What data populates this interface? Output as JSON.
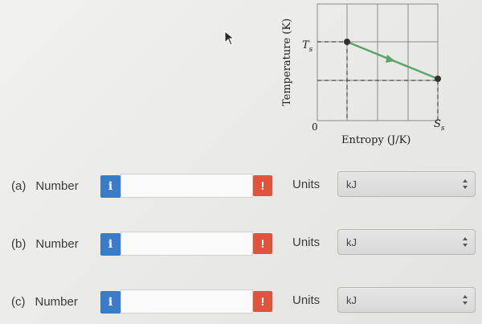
{
  "diagram": {
    "y_axis_label": "Temperature (K)",
    "x_axis_label": "Entropy (J/K)",
    "origin_label": "0",
    "y_marker_label": "T",
    "y_marker_sub": "s",
    "x_marker_label": "S",
    "x_marker_sub": "s"
  },
  "rows": [
    {
      "letter": "(a)",
      "label": "Number",
      "info_icon_text": "i",
      "value": "",
      "warn_icon_text": "!",
      "units_label": "Units",
      "units_value": "kJ"
    },
    {
      "letter": "(b)",
      "label": "Number",
      "info_icon_text": "i",
      "value": "",
      "warn_icon_text": "!",
      "units_label": "Units",
      "units_value": "kJ"
    },
    {
      "letter": "(c)",
      "label": "Number",
      "info_icon_text": "i",
      "value": "",
      "warn_icon_text": "!",
      "units_label": "Units",
      "units_value": "kJ"
    }
  ],
  "colors": {
    "info": "#3a7cc7",
    "warning": "#e0533c",
    "process_line": "#5aa66a"
  },
  "icons": [
    "cursor-arrow-icon",
    "info-icon",
    "warning-icon",
    "select-arrows-icon"
  ]
}
